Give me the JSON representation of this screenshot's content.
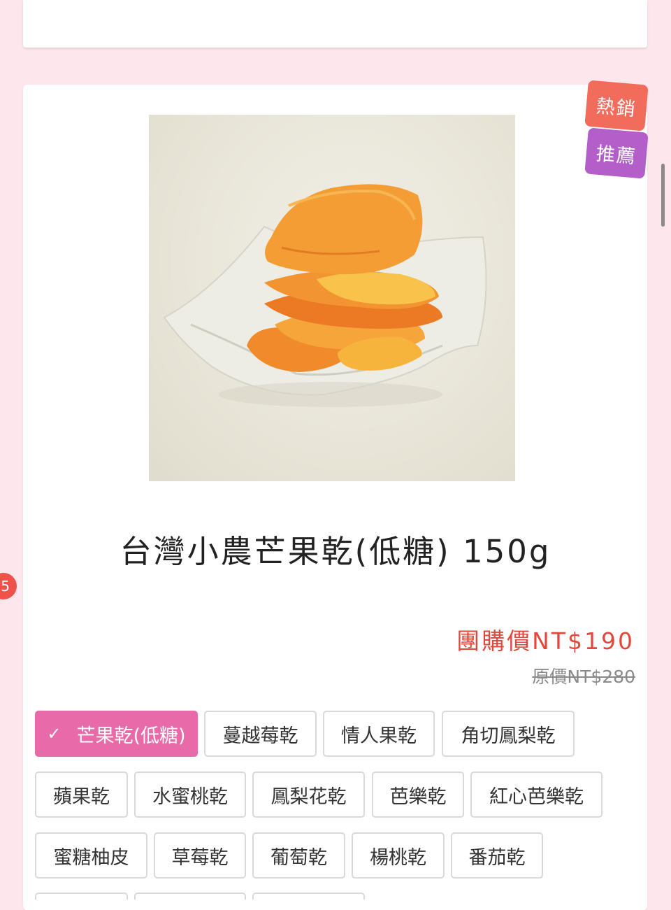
{
  "badges": {
    "hot": "熱銷",
    "recommend": "推薦"
  },
  "side_indicator": "5",
  "product": {
    "title": "台灣小農芒果乾(低糖) 150g",
    "group_price": "團購價NT$190",
    "original_price": "原價NT$280"
  },
  "variants": [
    {
      "label": "芒果乾(低糖)",
      "selected": true
    },
    {
      "label": "蔓越莓乾"
    },
    {
      "label": "情人果乾"
    },
    {
      "label": "角切鳳梨乾"
    },
    {
      "label": "蘋果乾"
    },
    {
      "label": "水蜜桃乾"
    },
    {
      "label": "鳳梨花乾"
    },
    {
      "label": "芭樂乾"
    },
    {
      "label": "紅心芭樂乾"
    },
    {
      "label": "蜜糖柚皮"
    },
    {
      "label": "草莓乾"
    },
    {
      "label": "葡萄乾"
    },
    {
      "label": "楊桃乾"
    },
    {
      "label": "番茄乾"
    }
  ],
  "colors": {
    "page_bg": "#fde6ec",
    "selected_chip": "#e86aa9",
    "price": "#e0483c",
    "hot_badge": "#f26c5c",
    "recommend_badge": "#b35ec9"
  },
  "icons": {
    "selected_mark": "check-icon"
  }
}
